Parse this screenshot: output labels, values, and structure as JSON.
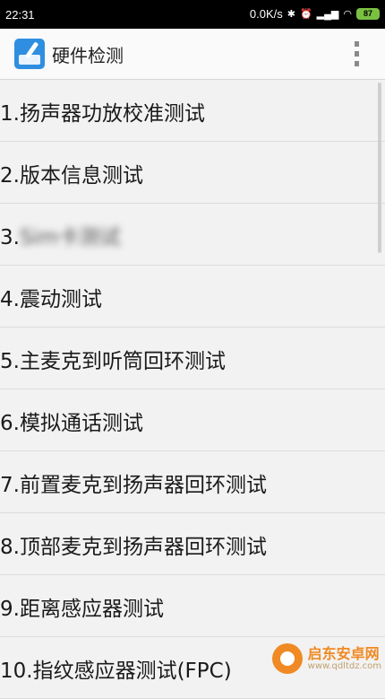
{
  "status_bar": {
    "time": "22:31",
    "speed": "0.0K/s",
    "battery": "87"
  },
  "app_bar": {
    "title": "硬件检测"
  },
  "list": {
    "items": [
      {
        "number": "1.",
        "label": "扬声器功放校准测试"
      },
      {
        "number": "2.",
        "label": "版本信息测试"
      },
      {
        "number": "3.",
        "label": "Sim卡测试"
      },
      {
        "number": "4.",
        "label": "震动测试"
      },
      {
        "number": "5.",
        "label": "主麦克到听筒回环测试"
      },
      {
        "number": "6.",
        "label": "模拟通话测试"
      },
      {
        "number": "7.",
        "label": "前置麦克到扬声器回环测试"
      },
      {
        "number": "8.",
        "label": "顶部麦克到扬声器回环测试"
      },
      {
        "number": "9.",
        "label": "距离感应器测试"
      },
      {
        "number": "10.",
        "label": "指纹感应器测试(FPC)"
      }
    ]
  },
  "watermark": {
    "name": "启东安卓网",
    "url": "www.qdltdz.com"
  },
  "colors": {
    "app_icon": "#2f8ee0",
    "battery": "#7ac142",
    "watermark": "#f08a24"
  }
}
